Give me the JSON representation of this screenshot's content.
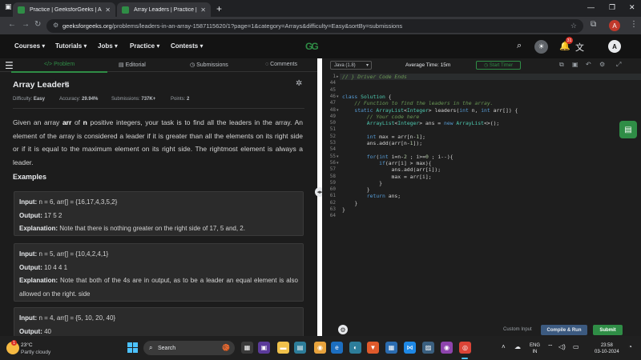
{
  "browser": {
    "tabs": [
      {
        "label": "Practice | GeeksforGeeks | A co",
        "active": false
      },
      {
        "label": "Array Leaders | Practice | Geeks",
        "active": true
      }
    ],
    "url_domain": "geeksforgeeks.org",
    "url_path": "/problems/leaders-in-an-array-1587115620/1?page=1&category=Arrays&difficulty=Easy&sortBy=submissions"
  },
  "site_nav": {
    "menus": [
      "Courses",
      "Tutorials",
      "Jobs",
      "Practice",
      "Contests"
    ],
    "logo_text": "GG",
    "notification_count": "31",
    "avatar_letter": "A"
  },
  "problem_tabs": {
    "problem": "Problem",
    "editorial": "Editorial",
    "submissions": "Submissions",
    "comments": "Comments"
  },
  "problem": {
    "title": "Array Leaders",
    "difficulty_label": "Difficulty:",
    "difficulty": "Easy",
    "accuracy_label": "Accuracy:",
    "accuracy": "29.94%",
    "submissions_label": "Submissions:",
    "submissions": "737K+",
    "points_label": "Points:",
    "points": "2",
    "desc_1": "Given an array ",
    "desc_arr": "arr",
    "desc_2": " of ",
    "desc_n": "n",
    "desc_3": " positive integers, your task is to find all the leaders in the array. An element of the array is considered a leader if it is greater than all the elements on its right side or if it is equal to the maximum element on its right side. The rightmost element is always a leader.",
    "examples_heading": "Examples",
    "examples": [
      {
        "input_label": "Input:",
        "input": "n = 6, arr[] = {16,17,4,3,5,2}",
        "output_label": "Output:",
        "output": "17 5 2",
        "explanation_label": "Explanation:",
        "explanation": "Note that there is nothing greater on the right side of 17, 5 and, 2."
      },
      {
        "input_label": "Input:",
        "input": "n = 5, arr[] = {10,4,2,4,1}",
        "output_label": "Output:",
        "output": "10 4 4 1",
        "explanation_label": "Explanation:",
        "explanation": "Note that both of the 4s are in output, as to be a leader an equal element is also allowed on the right. side"
      },
      {
        "input_label": "Input:",
        "input": "n = 4, arr[] = {5, 10, 20, 40}",
        "output_label": "Output:",
        "output": "40"
      }
    ]
  },
  "editor": {
    "language": "Java (1.8)",
    "avg_time": "Average Time: 15m",
    "start_timer": "Start Timer",
    "lines": [
      {
        "n": "1",
        "fold": "+",
        "html": "<span class='cm'>// } Driver Code Ends</span>"
      },
      {
        "n": "44",
        "html": ""
      },
      {
        "n": "45",
        "html": ""
      },
      {
        "n": "46",
        "fold": "-",
        "html": "<span class='kw'>class</span> <span class='ty'>Solution</span> {"
      },
      {
        "n": "47",
        "html": "    <span class='cm'>// Function to find the leaders in the array.</span>"
      },
      {
        "n": "48",
        "fold": "-",
        "html": "    <span class='kw'>static</span> <span class='ty'>ArrayList</span>&lt;<span class='ty'>Integer</span>&gt; leaders(<span class='kw'>int</span> n, <span class='kw'>int</span> arr[]) {"
      },
      {
        "n": "49",
        "html": "        <span class='cm'>// Your code here</span>"
      },
      {
        "n": "50",
        "html": "        <span class='ty'>ArrayList</span>&lt;<span class='ty'>Integer</span>&gt; ans = <span class='kw'>new</span> <span class='ty'>ArrayList</span>&lt;&gt;();"
      },
      {
        "n": "51",
        "html": ""
      },
      {
        "n": "52",
        "html": "        <span class='kw'>int</span> max = arr[n-<span class='nm'>1</span>];"
      },
      {
        "n": "53",
        "html": "        ans.add(arr[n-<span class='nm'>1</span>]);"
      },
      {
        "n": "54",
        "html": ""
      },
      {
        "n": "55",
        "fold": "-",
        "html": "        <span class='kw'>for</span>(<span class='kw'>int</span> i=n-<span class='nm'>2</span> ; i&gt;=<span class='nm'>0</span> ; i--){"
      },
      {
        "n": "56",
        "fold": "-",
        "html": "            <span class='kw'>if</span>(arr[i] &gt; max){"
      },
      {
        "n": "57",
        "html": "                ans.add(arr[i]);"
      },
      {
        "n": "58",
        "html": "                max = arr[i];"
      },
      {
        "n": "59",
        "html": "            }"
      },
      {
        "n": "60",
        "html": "        }"
      },
      {
        "n": "61",
        "html": "        <span class='kw'>return</span> ans;"
      },
      {
        "n": "62",
        "html": "    }"
      },
      {
        "n": "63",
        "html": "}"
      },
      {
        "n": "64",
        "html": ""
      }
    ],
    "custom_input": "Custom Input",
    "compile_run": "Compile & Run",
    "submit": "Submit"
  },
  "taskbar": {
    "weather_badge": "1",
    "temp": "23°C",
    "weather": "Partly cloudy",
    "search": "Search",
    "lang_top": "ENG",
    "lang_bottom": "IN",
    "time": "23:58",
    "date": "03-10-2024"
  },
  "colors": {
    "gfg_green": "#2f8d46",
    "editor_bg": "#1e1e1e",
    "compile_blue": "#3c5a80"
  }
}
